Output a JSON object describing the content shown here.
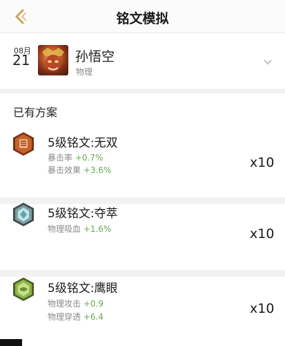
{
  "header": {
    "title": "铭文模拟",
    "back_icon": "chevron-left-icon",
    "accent": "#c8a15a"
  },
  "hero": {
    "month": "08月",
    "day": "21",
    "name": "孙悟空",
    "type": "物理",
    "expand_icon": "chevron-down-icon"
  },
  "plans": {
    "title": "已有方案",
    "runes": [
      {
        "name": "5级铭文:无双",
        "color": "#c2622c",
        "icon": "red-rune-icon",
        "attrs": [
          {
            "label": "暴击率",
            "value": "+0.7%"
          },
          {
            "label": "暴击效果",
            "value": "+3.6%"
          }
        ],
        "count": "x10"
      },
      {
        "name": "5级铭文:夺萃",
        "color": "#5fa6a8",
        "icon": "blue-rune-icon",
        "attrs": [
          {
            "label": "物理吸血",
            "value": "+1.6%"
          }
        ],
        "count": "x10"
      },
      {
        "name": "5级铭文:鹰眼",
        "color": "#8db54a",
        "icon": "green-rune-icon",
        "attrs": [
          {
            "label": "物理攻击",
            "value": "+0.9"
          },
          {
            "label": "物理穿透",
            "value": "+6.4"
          }
        ],
        "count": "x10"
      }
    ]
  },
  "colors": {
    "attr_value": "#6aa84f"
  }
}
